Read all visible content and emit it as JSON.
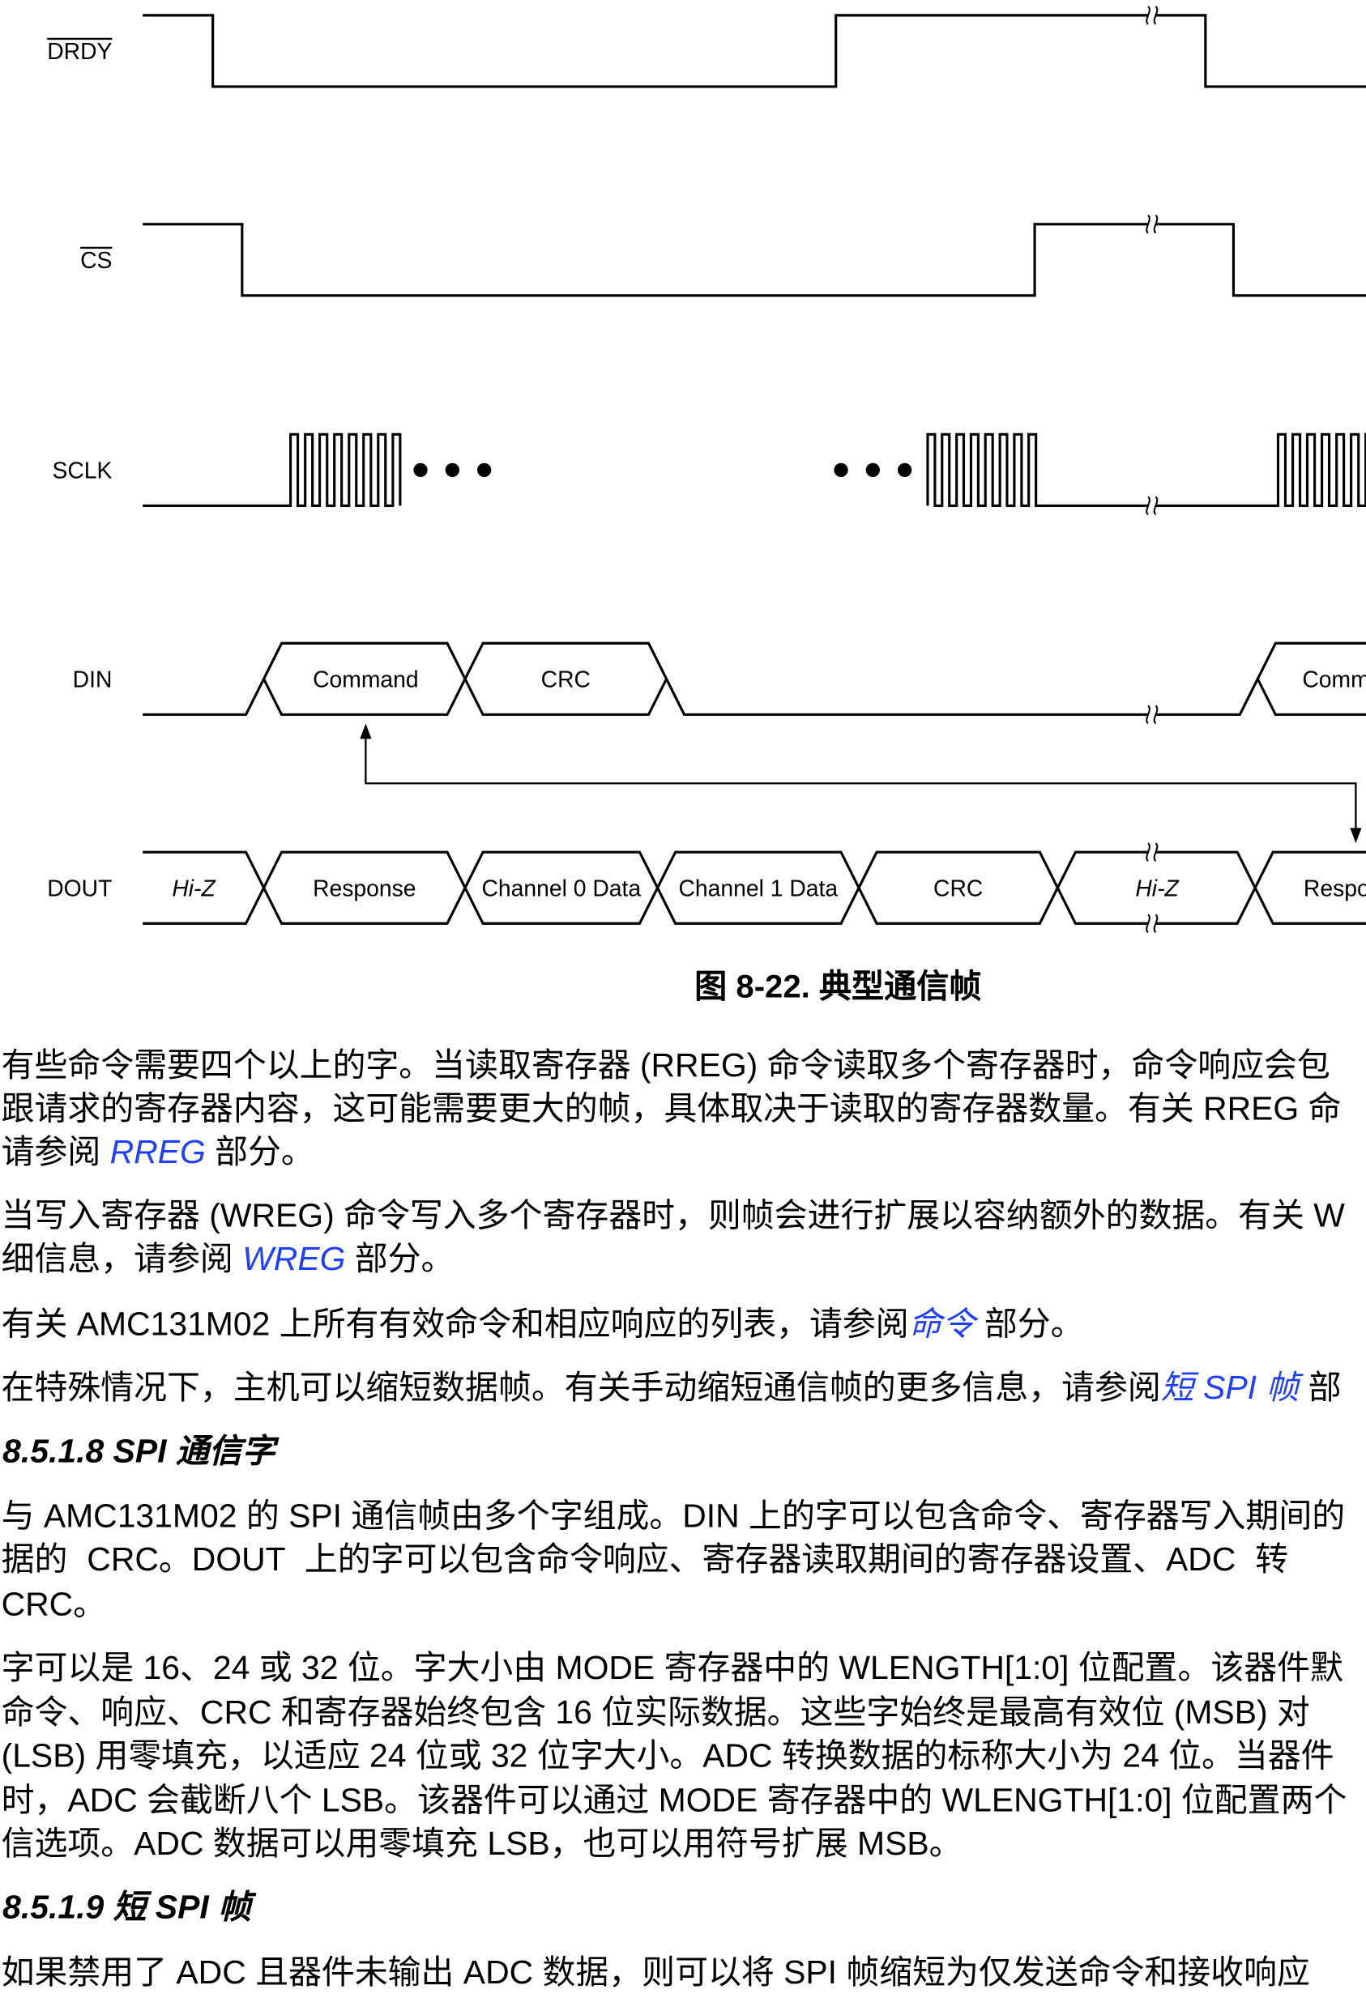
{
  "theme": {
    "text_color": "#000000",
    "link_color": "#1f3fff"
  },
  "figure": {
    "signals": {
      "drdy": "DRDY",
      "cs": "CS",
      "sclk": "SCLK",
      "din": "DIN",
      "dout": "DOUT"
    },
    "din_fields": [
      "Command",
      "CRC",
      "Comm"
    ],
    "dout_fields": [
      "Hi-Z",
      "Response",
      "Channel 0 Data",
      "Channel 1 Data",
      "CRC",
      "Hi-Z",
      "Respo"
    ],
    "caption": "图 8-22. 典型通信帧"
  },
  "text": {
    "para1": {
      "line1": "有些命令需要四个以上的字。当读取寄存器 (RREG) 命令读取多个寄存器时，命令响应会包",
      "line2": "跟请求的寄存器内容，这可能需要更大的帧，具体取决于读取的寄存器数量。有关 RREG 命",
      "line3": {
        "pre": "请参阅 ",
        "link": "RREG",
        "post": " 部分。"
      }
    },
    "para2": {
      "line1": "当写入寄存器 (WREG) 命令写入多个寄存器时，则帧会进行扩展以容纳额外的数据。有关 W",
      "line2": {
        "pre": "细信息，请参阅 ",
        "link": "WREG",
        "post": " 部分。"
      }
    },
    "para3": {
      "line1": {
        "pre": "有关 AMC131M02 上所有有效命令和相应响应的列表，请参阅",
        "link": "命令",
        "post": " 部分。"
      }
    },
    "para4": {
      "line1": {
        "pre": "在特殊情况下，主机可以缩短数据帧。有关手动缩短通信帧的更多信息，请参阅",
        "link": "短 SPI 帧",
        "post": " 部"
      }
    },
    "heading_8518": "8.5.1.8 SPI 通信字",
    "para5": {
      "line1": "与 AMC131M02 的 SPI 通信帧由多个字组成。DIN 上的字可以包含命令、寄存器写入期间的",
      "line2": "据的 CRC。DOUT 上的字可以包含命令响应、寄存器读取期间的寄存器设置、ADC 转",
      "line3": "CRC。"
    },
    "para6": {
      "line1": "字可以是 16、24 或 32 位。字大小由 MODE 寄存器中的 WLENGTH[1:0] 位配置。该器件默",
      "line2": "命令、响应、CRC 和寄存器始终包含 16 位实际数据。这些字始终是最高有效位 (MSB) 对",
      "line3": "(LSB) 用零填充，以适应 24 位或 32 位字大小。ADC 转换数据的标称大小为 24 位。当器件",
      "line4": "时，ADC 会截断八个 LSB。该器件可以通过 MODE 寄存器中的 WLENGTH[1:0] 位配置两个",
      "line5": "信选项。ADC 数据可以用零填充 LSB，也可以用符号扩展 MSB。"
    },
    "heading_8519": "8.5.1.9 短 SPI 帧",
    "para7": {
      "line1": "如果禁用了 ADC 且器件未输出 ADC 数据，则可以将 SPI 帧缩短为仅发送命令和接收响应"
    }
  }
}
